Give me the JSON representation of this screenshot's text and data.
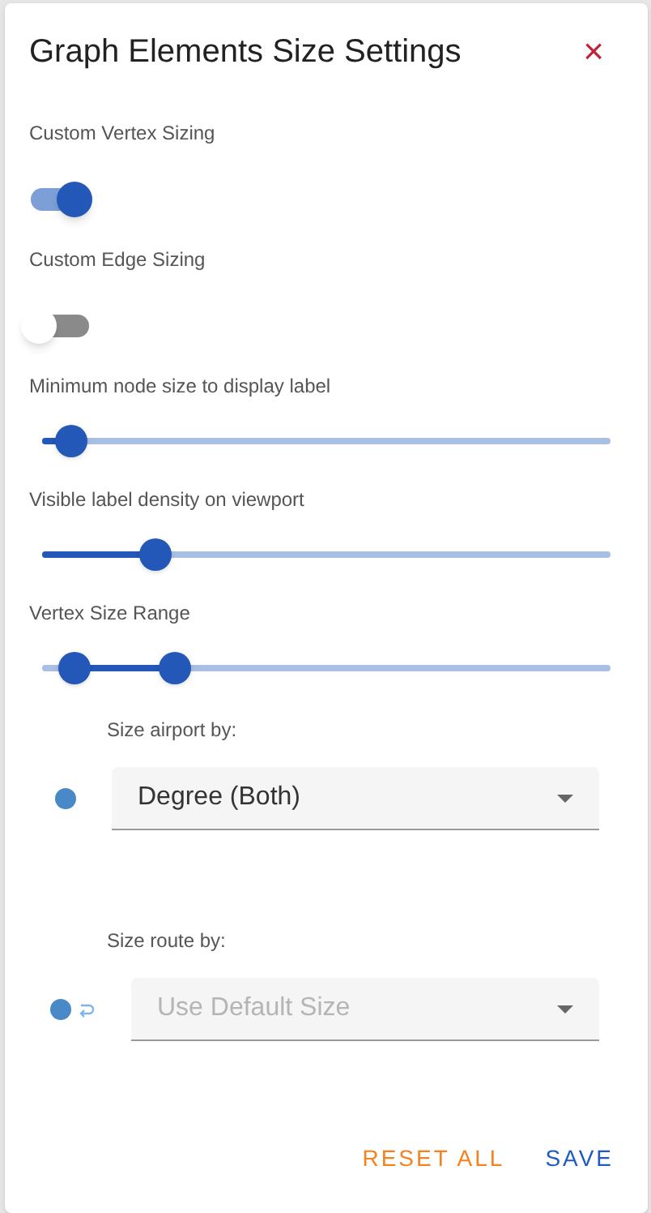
{
  "dialog": {
    "title": "Graph Elements Size Settings",
    "close": "×"
  },
  "toggles": [
    {
      "label": "Custom Vertex Sizing",
      "on": true
    },
    {
      "label": "Custom Edge Sizing",
      "on": false
    }
  ],
  "sliders": [
    {
      "label": "Minimum node size to display label",
      "kind": "single",
      "thumbs": [
        {
          "level": 0.05
        }
      ]
    },
    {
      "label": "Visible label density on viewport",
      "kind": "single",
      "thumbs": [
        {
          "level": 0.2
        }
      ]
    },
    {
      "label": "Vertex Size Range",
      "kind": "range",
      "thumbs": [
        {
          "level": 0.057
        },
        {
          "level": 0.234
        }
      ]
    }
  ],
  "selects": [
    {
      "label": "Size airport by:",
      "kind": "node",
      "value": "Degree (Both)",
      "disabled": false
    },
    {
      "label": "Size route by:",
      "kind": "edge",
      "value": "Use Default Size",
      "disabled": true
    }
  ],
  "buttons": [
    {
      "label": "RESET ALL",
      "kind": "reset"
    },
    {
      "label": "SAVE",
      "kind": "save"
    }
  ]
}
